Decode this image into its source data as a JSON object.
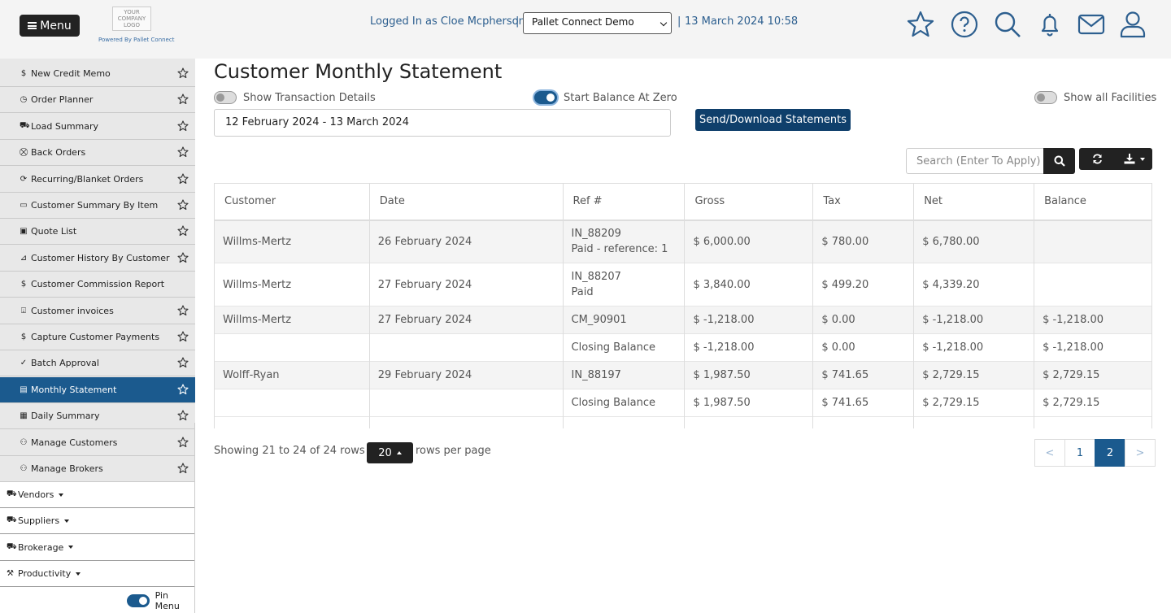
{
  "header": {
    "menu_label": "Menu",
    "logo_text": "YOUR COMPANY LOGO",
    "powered_by": "Powered By Pallet Connect",
    "logged_in": "Logged In as Cloe Mcpherson",
    "separator": "|",
    "facility_selected": "Pallet Connect Demo",
    "datetime": "13 March 2024 10:58",
    "icons": [
      "star-icon",
      "help-icon",
      "search-icon",
      "bell-icon",
      "mail-icon",
      "user-icon"
    ]
  },
  "sidebar": {
    "items": [
      {
        "label": "New Credit Memo",
        "icon": "$"
      },
      {
        "label": "Order Planner",
        "icon": "◷"
      },
      {
        "label": "Load Summary",
        "icon": "⛟"
      },
      {
        "label": "Back Orders",
        "icon": "⛒"
      },
      {
        "label": "Recurring/Blanket Orders",
        "icon": "⟳"
      },
      {
        "label": "Customer Summary By Item",
        "icon": "▭"
      },
      {
        "label": "Quote List",
        "icon": "▣"
      },
      {
        "label": "Customer History By Customer",
        "icon": "⊿"
      },
      {
        "label": "Customer Commission Report",
        "icon": "$"
      },
      {
        "label": "Customer invoices",
        "icon": "⍗"
      },
      {
        "label": "Capture Customer Payments",
        "icon": "$"
      },
      {
        "label": "Batch Approval",
        "icon": "✓"
      },
      {
        "label": "Monthly Statement",
        "icon": "▤"
      },
      {
        "label": "Daily Summary",
        "icon": "▦"
      },
      {
        "label": "Manage Customers",
        "icon": "⚇"
      },
      {
        "label": "Manage Brokers",
        "icon": "⚇"
      }
    ],
    "groups": [
      {
        "label": "Vendors",
        "icon": "⛟"
      },
      {
        "label": "Suppliers",
        "icon": "⛟"
      },
      {
        "label": "Brokerage",
        "icon": "⛟"
      },
      {
        "label": "Productivity",
        "icon": "⚒"
      }
    ],
    "pin_label": "Pin Menu"
  },
  "main": {
    "title": "Customer Monthly Statement",
    "show_transaction_details": "Show Transaction Details",
    "start_balance_at_zero": "Start Balance At Zero",
    "show_all_facilities": "Show all Facilities",
    "date_range": "12 February 2024 - 13 March 2024",
    "send_button": "Send/Download Statements",
    "search_placeholder": "Search (Enter To Apply)",
    "table": {
      "headers": [
        "Customer",
        "Date",
        "Ref #",
        "Gross",
        "Tax",
        "Net",
        "Balance"
      ],
      "rows": [
        {
          "customer": "Willms-Mertz",
          "date": "26 February 2024",
          "ref": "IN_88209",
          "ref_note": "Paid - reference: 1",
          "gross": "$ 6,000.00",
          "tax": "$ 780.00",
          "net": "$ 6,780.00",
          "balance": ""
        },
        {
          "customer": "Willms-Mertz",
          "date": "27 February 2024",
          "ref": "IN_88207",
          "ref_note": "Paid",
          "gross": "$ 3,840.00",
          "tax": "$ 499.20",
          "net": "$ 4,339.20",
          "balance": ""
        },
        {
          "customer": "Willms-Mertz",
          "date": "27 February 2024",
          "ref": "CM_90901",
          "ref_note": "",
          "gross": "$ -1,218.00",
          "tax": "$ 0.00",
          "net": "$ -1,218.00",
          "balance": "$ -1,218.00"
        },
        {
          "customer": "",
          "date": "",
          "ref": "Closing Balance",
          "ref_note": "",
          "gross": "$ -1,218.00",
          "tax": "$ 0.00",
          "net": "$ -1,218.00",
          "balance": "$ -1,218.00"
        },
        {
          "customer": "Wolff-Ryan",
          "date": "29 February 2024",
          "ref": "IN_88197",
          "ref_note": "",
          "gross": "$ 1,987.50",
          "tax": "$ 741.65",
          "net": "$ 2,729.15",
          "balance": "$ 2,729.15"
        },
        {
          "customer": "",
          "date": "",
          "ref": "Closing Balance",
          "ref_note": "",
          "gross": "$ 1,987.50",
          "tax": "$ 741.65",
          "net": "$ 2,729.15",
          "balance": "$ 2,729.15"
        }
      ]
    },
    "pagination": {
      "showing": "Showing 21 to 24 of 24 rows",
      "per_page": "20",
      "rows_per_page": "rows per page",
      "prev": "<",
      "pages": [
        "1",
        "2"
      ],
      "next": ">"
    }
  }
}
